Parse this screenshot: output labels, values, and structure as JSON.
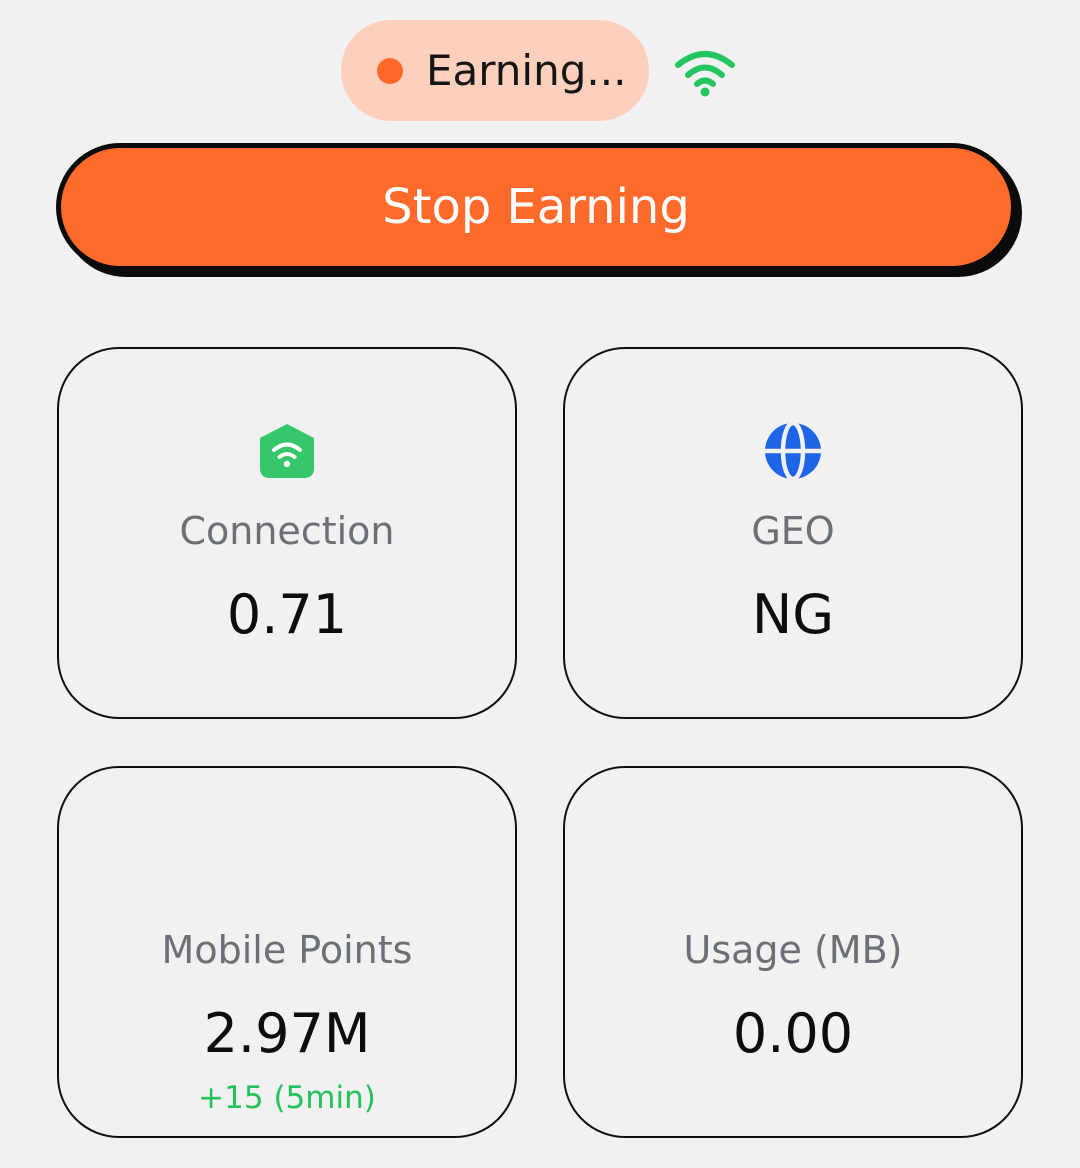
{
  "status": {
    "text": "Earning...",
    "dot_color": "#fe6829",
    "pill_color": "#fdcfbd",
    "signal_icon": "wifi-icon",
    "signal_color": "#22c55e"
  },
  "action": {
    "label": "Stop Earning",
    "color": "#fe6a2b"
  },
  "cards": {
    "connection": {
      "icon": "home-wifi-icon",
      "label": "Connection",
      "value": "0.71"
    },
    "geo": {
      "icon": "globe-icon",
      "label": "GEO",
      "value": "NG"
    },
    "points": {
      "label": "Mobile Points",
      "value": "2.97M",
      "delta": "+15 (5min)"
    },
    "usage": {
      "label": "Usage (MB)",
      "value": "0.00"
    }
  },
  "colors": {
    "background": "#f2f1f1",
    "accent": "#fe6a2b",
    "success": "#23c25b",
    "globe": "#1f63e6"
  }
}
